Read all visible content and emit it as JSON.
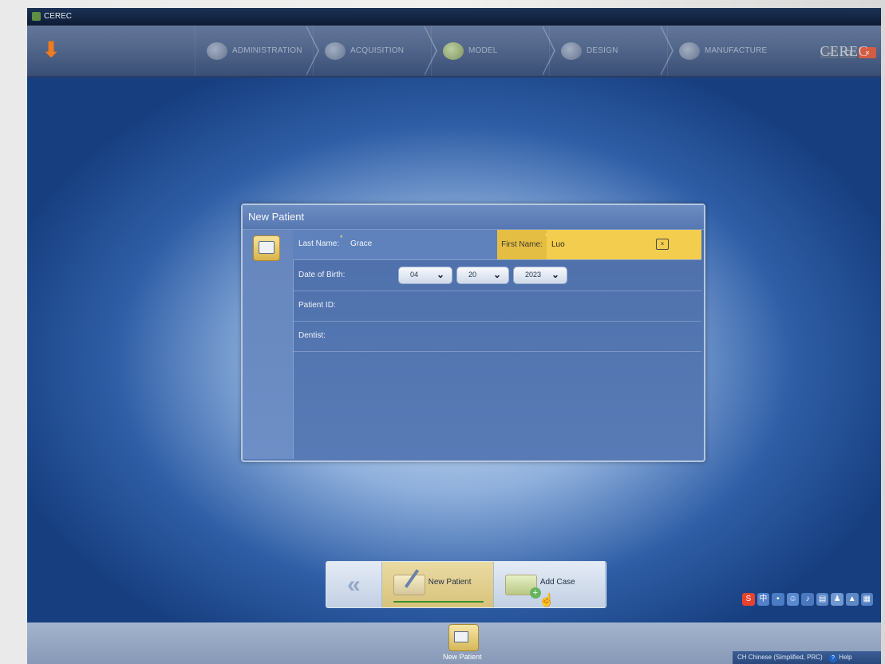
{
  "window": {
    "title": "CEREC"
  },
  "brand": "CEREC",
  "nav": {
    "steps": [
      {
        "label": "ADMINISTRATION"
      },
      {
        "label": "ACQUISITION"
      },
      {
        "label": "MODEL"
      },
      {
        "label": "DESIGN"
      },
      {
        "label": "MANUFACTURE"
      }
    ]
  },
  "dialog": {
    "title": "New Patient",
    "last_name_label": "Last Name:",
    "last_name_value": "Grace",
    "first_name_label": "First Name:",
    "first_name_value": "Luo",
    "dob_label": "Date of Birth:",
    "dob_month": "04",
    "dob_day": "20",
    "dob_year": "2023",
    "patient_id_label": "Patient ID:",
    "dentist_label": "Dentist:"
  },
  "action_bar": {
    "new_patient_label": "New Patient",
    "add_case_label": "Add Case"
  },
  "bottom": {
    "label": "New Patient"
  },
  "tray": {
    "language": "CH Chinese (Simplified, PRC)",
    "help": "Help"
  }
}
